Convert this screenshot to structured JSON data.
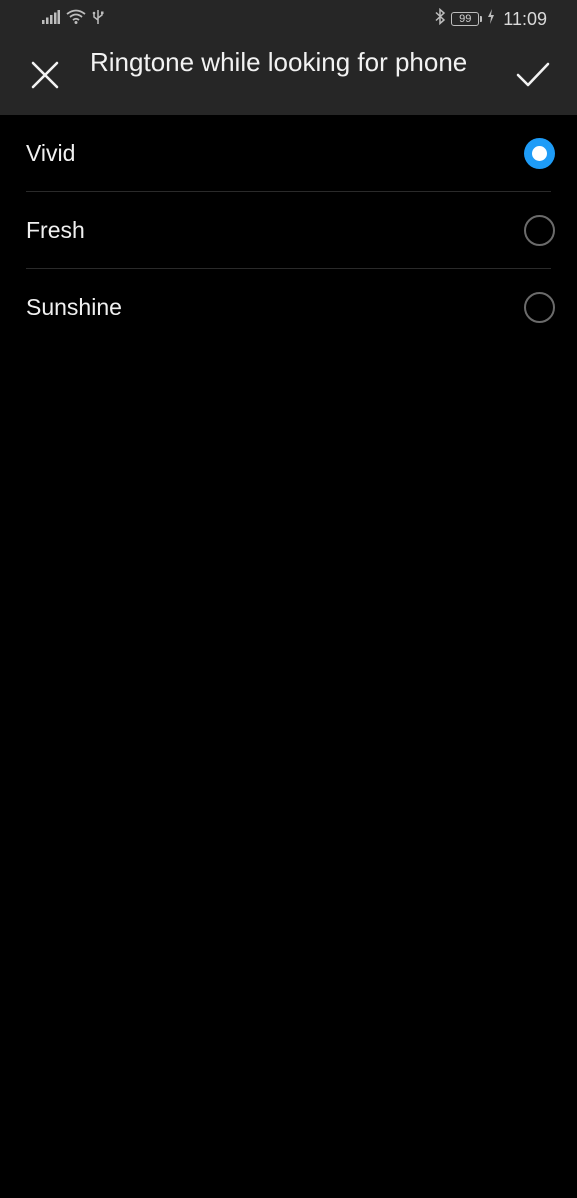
{
  "status_bar": {
    "time": "11:09",
    "battery": "99",
    "icons": [
      "signal-icon",
      "wifi-icon",
      "usb-icon",
      "bluetooth-icon",
      "battery-icon",
      "charging-icon"
    ]
  },
  "header": {
    "title": "Ringtone while looking for phone",
    "close_icon": "close-icon",
    "confirm_icon": "check-icon"
  },
  "options": [
    {
      "label": "Vivid",
      "selected": true
    },
    {
      "label": "Fresh",
      "selected": false
    },
    {
      "label": "Sunshine",
      "selected": false
    }
  ],
  "colors": {
    "accent": "#1e9cf7",
    "header_bg": "#262626",
    "background": "#000000"
  }
}
